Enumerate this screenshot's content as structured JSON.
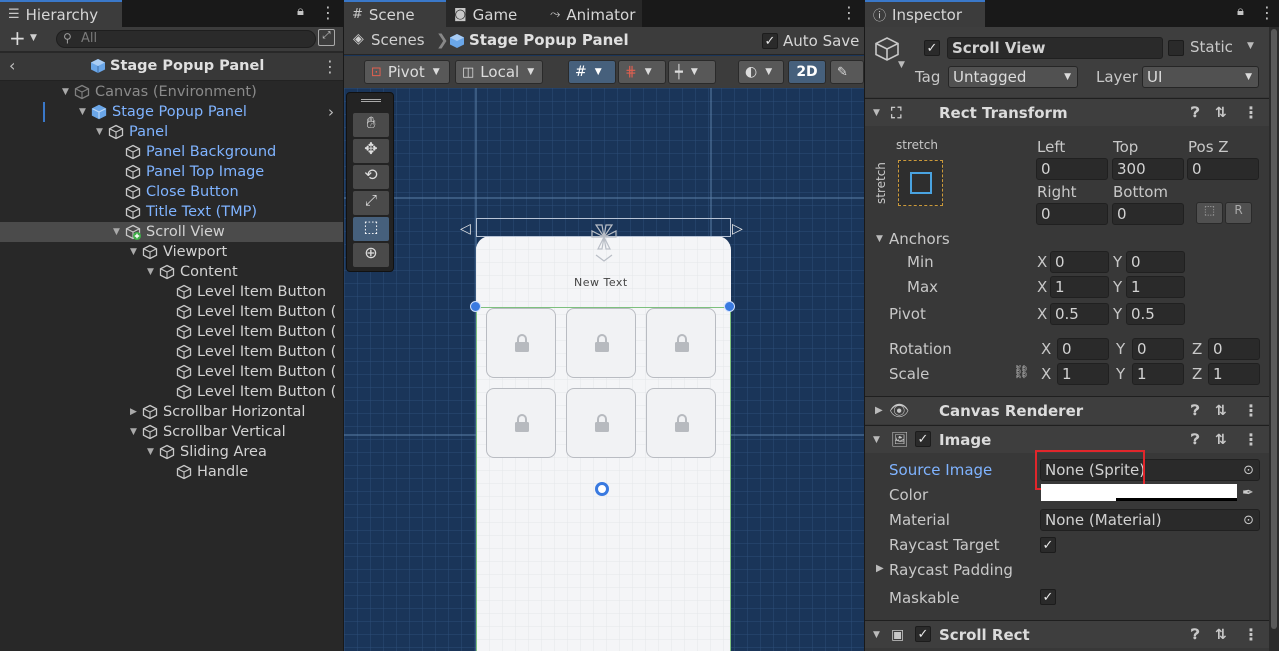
{
  "hierarchy": {
    "tab_label": "Hierarchy",
    "search_placeholder": "All",
    "add_label": "+",
    "breadcrumb": "Stage Popup Panel",
    "rows": [
      {
        "label": "Canvas (Environment)",
        "depth": 0,
        "expand": "open",
        "style": "dim"
      },
      {
        "label": "Stage Popup Panel",
        "depth": 1,
        "expand": "open",
        "style": "blue"
      },
      {
        "label": "Panel",
        "depth": 2,
        "expand": "open",
        "style": "blue"
      },
      {
        "label": "Panel Background",
        "depth": 3,
        "expand": "none",
        "style": "blue"
      },
      {
        "label": "Panel Top Image",
        "depth": 3,
        "expand": "none",
        "style": "blue"
      },
      {
        "label": "Close Button",
        "depth": 3,
        "expand": "none",
        "style": "blue"
      },
      {
        "label": "Title Text (TMP)",
        "depth": 3,
        "expand": "none",
        "style": "blue"
      },
      {
        "label": "Scroll View",
        "depth": 3,
        "expand": "open",
        "style": "normal",
        "selected": true
      },
      {
        "label": "Viewport",
        "depth": 4,
        "expand": "open",
        "style": "normal"
      },
      {
        "label": "Content",
        "depth": 5,
        "expand": "open",
        "style": "normal"
      },
      {
        "label": "Level Item Button",
        "depth": 6,
        "expand": "none",
        "style": "normal"
      },
      {
        "label": "Level Item Button (",
        "depth": 6,
        "expand": "none",
        "style": "normal"
      },
      {
        "label": "Level Item Button (",
        "depth": 6,
        "expand": "none",
        "style": "normal"
      },
      {
        "label": "Level Item Button (",
        "depth": 6,
        "expand": "none",
        "style": "normal"
      },
      {
        "label": "Level Item Button (",
        "depth": 6,
        "expand": "none",
        "style": "normal"
      },
      {
        "label": "Level Item Button (",
        "depth": 6,
        "expand": "none",
        "style": "normal"
      },
      {
        "label": "Scrollbar Horizontal",
        "depth": 4,
        "expand": "closed",
        "style": "normal"
      },
      {
        "label": "Scrollbar Vertical",
        "depth": 4,
        "expand": "open",
        "style": "normal"
      },
      {
        "label": "Sliding Area",
        "depth": 5,
        "expand": "open",
        "style": "normal"
      },
      {
        "label": "Handle",
        "depth": 6,
        "expand": "none",
        "style": "normal"
      }
    ]
  },
  "scene": {
    "tabs": [
      "Scene",
      "Game",
      "Animator"
    ],
    "breadcrumb_root": "Scenes",
    "breadcrumb_current": "Stage Popup Panel",
    "auto_save_label": "Auto Save",
    "pivot_label": "Pivot",
    "local_label": "Local",
    "mode_2d": "2D",
    "canvas_title": "New Text"
  },
  "inspector": {
    "tab_label": "Inspector",
    "object_name": "Scroll View",
    "static_label": "Static",
    "tag_label": "Tag",
    "tag_value": "Untagged",
    "layer_label": "Layer",
    "layer_value": "UI",
    "rect_transform": {
      "title": "Rect Transform",
      "stretch_top": "stretch",
      "stretch_side": "stretch",
      "left_label": "Left",
      "left": "0",
      "top_label": "Top",
      "top": "300",
      "posz_label": "Pos Z",
      "posz": "0",
      "right_label": "Right",
      "right": "0",
      "bottom_label": "Bottom",
      "bottom": "0",
      "anchors_label": "Anchors",
      "min_label": "Min",
      "min_x": "0",
      "min_y": "0",
      "max_label": "Max",
      "max_x": "1",
      "max_y": "1",
      "pivot_label": "Pivot",
      "pivot_x": "0.5",
      "pivot_y": "0.5",
      "rotation_label": "Rotation",
      "rot_x": "0",
      "rot_y": "0",
      "rot_z": "0",
      "scale_label": "Scale",
      "scale_x": "1",
      "scale_y": "1",
      "scale_z": "1",
      "x": "X",
      "y": "Y",
      "z": "Z"
    },
    "canvas_renderer_title": "Canvas Renderer",
    "image": {
      "title": "Image",
      "source_image_label": "Source Image",
      "source_image_value": "None (Sprite)",
      "color_label": "Color",
      "material_label": "Material",
      "material_value": "None (Material)",
      "raycast_target_label": "Raycast Target",
      "raycast_padding_label": "Raycast Padding",
      "maskable_label": "Maskable"
    },
    "scroll_rect_title": "Scroll Rect",
    "highlight_color": "#e0262b"
  }
}
